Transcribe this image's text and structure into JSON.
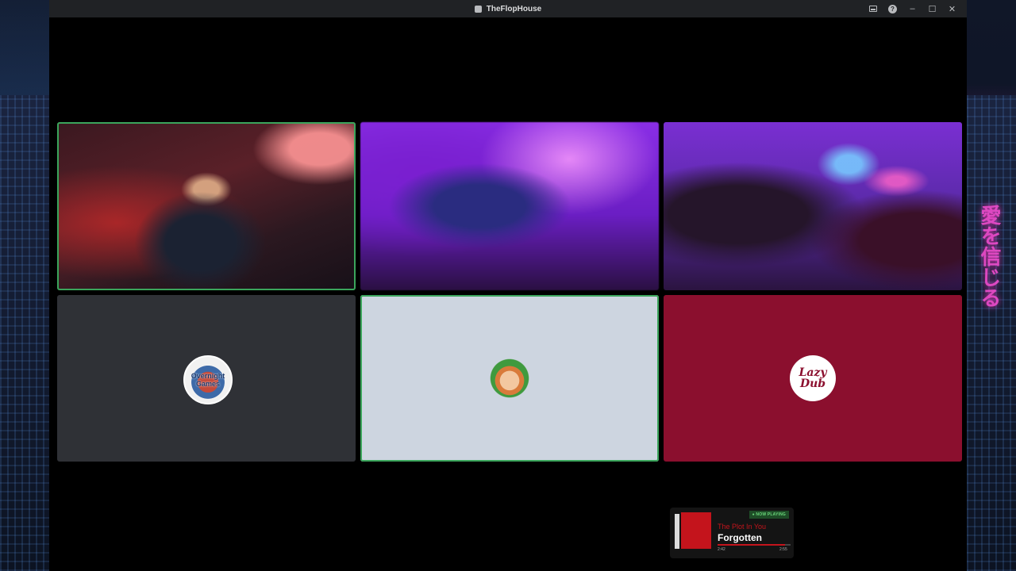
{
  "window": {
    "title": "TheFlopHouse",
    "controls": {
      "inbox_icon": "inbox-icon",
      "help_icon": "help-icon",
      "minimize": "–",
      "maximize": "☐",
      "close": "✕"
    }
  },
  "participants": [
    {
      "type": "video",
      "speaking": true
    },
    {
      "type": "video",
      "speaking": false
    },
    {
      "type": "video",
      "speaking": false
    },
    {
      "type": "avatar",
      "speaking": false,
      "avatar_text": "Overnight Games",
      "color": "#2f3136"
    },
    {
      "type": "avatar",
      "speaking": true,
      "color": "#cdd5e0"
    },
    {
      "type": "avatar",
      "speaking": false,
      "avatar_text": "Lazy Dub",
      "color": "#8b0f2e"
    }
  ],
  "desktop_sign_text": "愛を信じる",
  "now_playing": {
    "badge": "● NOW PLAYING",
    "artist": "The Plot In You",
    "song": "Forgotten",
    "elapsed": "2:42",
    "total": "2:55",
    "progress_percent": 92
  },
  "colors": {
    "speaking_outline": "#3ba55c",
    "titlebar": "#202225",
    "accent_red": "#c4141c"
  }
}
